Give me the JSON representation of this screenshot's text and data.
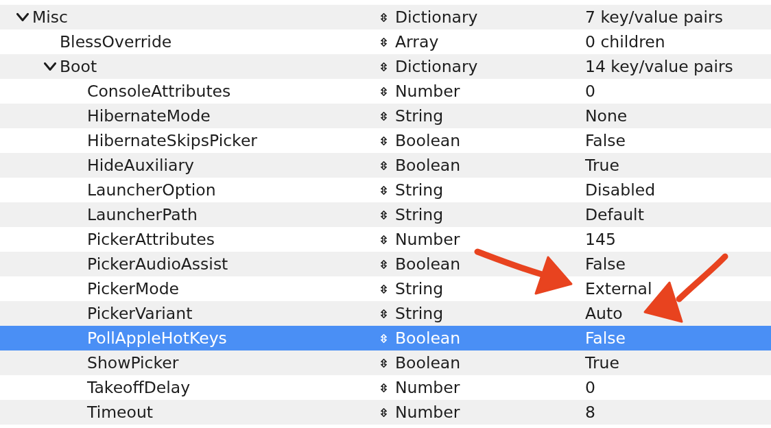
{
  "tree": {
    "rows": [
      {
        "key": "Misc",
        "type": "Dictionary",
        "value": "7 key/value pairs",
        "expanded": true,
        "selected": false,
        "children": [
          {
            "key": "BlessOverride",
            "type": "Array",
            "value": "0 children",
            "selected": false
          },
          {
            "key": "Boot",
            "type": "Dictionary",
            "value": "14 key/value pairs",
            "expanded": true,
            "selected": false,
            "children": [
              {
                "key": "ConsoleAttributes",
                "type": "Number",
                "value": "0",
                "selected": false
              },
              {
                "key": "HibernateMode",
                "type": "String",
                "value": "None",
                "selected": false
              },
              {
                "key": "HibernateSkipsPicker",
                "type": "Boolean",
                "value": "False",
                "selected": false
              },
              {
                "key": "HideAuxiliary",
                "type": "Boolean",
                "value": "True",
                "selected": false
              },
              {
                "key": "LauncherOption",
                "type": "String",
                "value": "Disabled",
                "selected": false
              },
              {
                "key": "LauncherPath",
                "type": "String",
                "value": "Default",
                "selected": false
              },
              {
                "key": "PickerAttributes",
                "type": "Number",
                "value": "145",
                "selected": false
              },
              {
                "key": "PickerAudioAssist",
                "type": "Boolean",
                "value": "False",
                "selected": false
              },
              {
                "key": "PickerMode",
                "type": "String",
                "value": "External",
                "selected": false
              },
              {
                "key": "PickerVariant",
                "type": "String",
                "value": "Auto",
                "selected": false
              },
              {
                "key": "PollAppleHotKeys",
                "type": "Boolean",
                "value": "False",
                "selected": true
              },
              {
                "key": "ShowPicker",
                "type": "Boolean",
                "value": "True",
                "selected": false
              },
              {
                "key": "TakeoffDelay",
                "type": "Number",
                "value": "0",
                "selected": false
              },
              {
                "key": "Timeout",
                "type": "Number",
                "value": "8",
                "selected": false
              }
            ]
          }
        ]
      }
    ]
  }
}
